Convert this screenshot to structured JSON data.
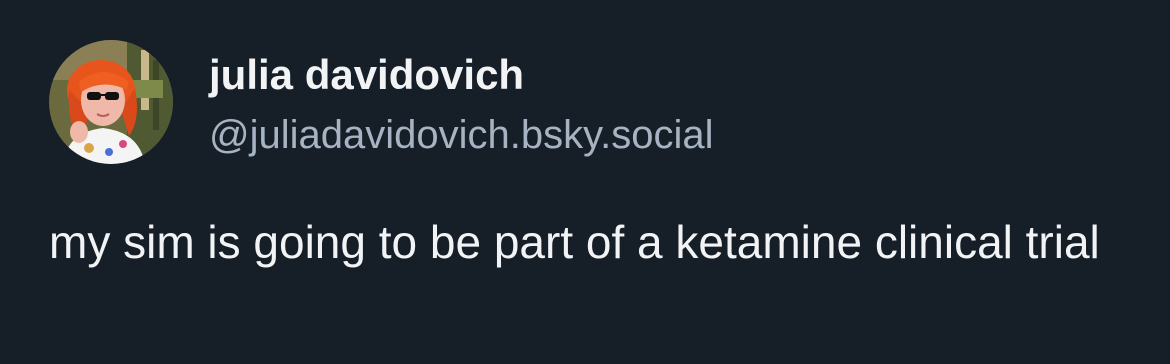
{
  "post": {
    "author": {
      "display_name": "julia davidovich",
      "handle": "@juliadavidovich.bsky.social",
      "avatar_icon": "profile-photo"
    },
    "text": "my sim is going to be part of a ketamine clinical trial"
  },
  "colors": {
    "background": "#161e27",
    "primary_text": "#f1f3f5",
    "secondary_text": "#a6b3c2"
  }
}
